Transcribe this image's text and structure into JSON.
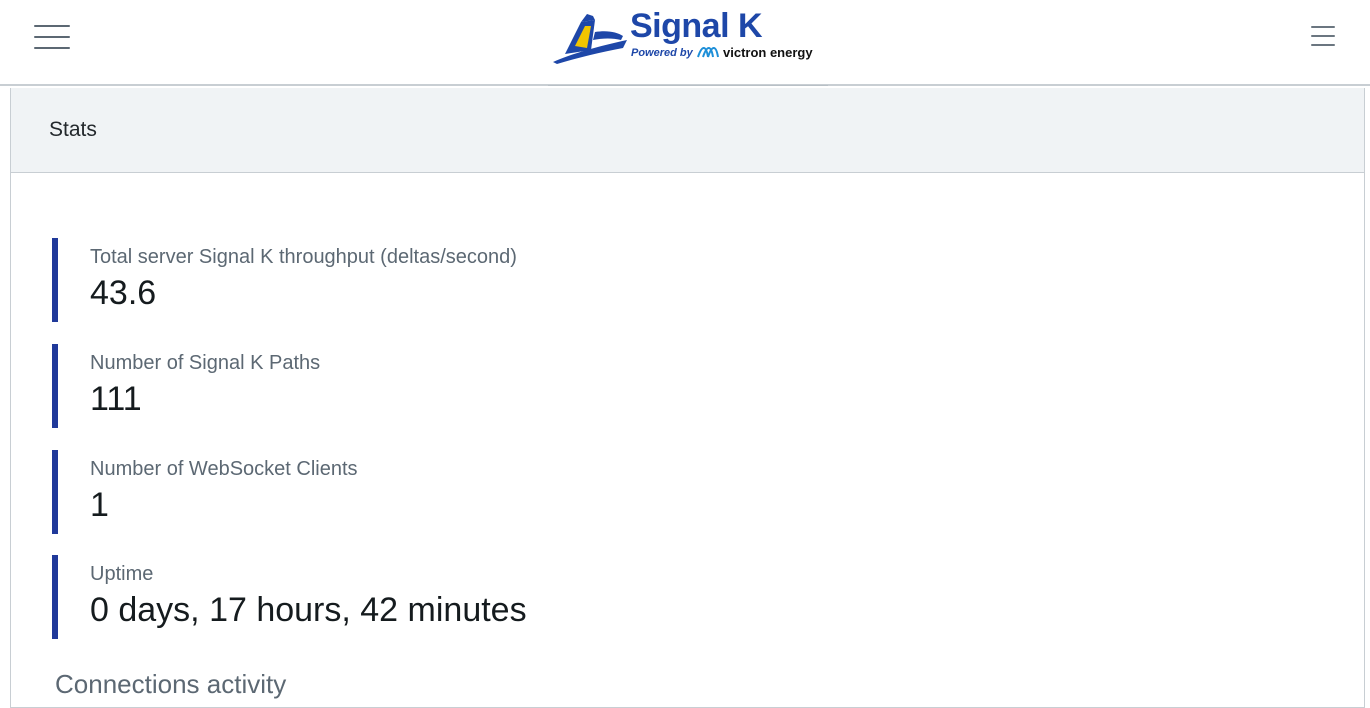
{
  "header": {
    "brand_title": "Signal K",
    "brand_powered": "Powered by",
    "brand_partner": "victron energy",
    "icons": {
      "left_menu": "hamburger-menu-icon",
      "right_menu": "hamburger-menu-icon"
    },
    "colors": {
      "brand_blue": "#1e47a8",
      "brand_yellow": "#f2c500"
    }
  },
  "card": {
    "title": "Stats",
    "stats": [
      {
        "label": "Total server Signal K throughput (deltas/second)",
        "value": "43.6"
      },
      {
        "label": "Number of Signal K Paths",
        "value": "111"
      },
      {
        "label": "Number of WebSocket Clients",
        "value": "1"
      },
      {
        "label": "Uptime",
        "value": "0 days, 17 hours, 42 minutes"
      }
    ],
    "section_title": "Connections activity",
    "accent_color": "#20399a"
  }
}
